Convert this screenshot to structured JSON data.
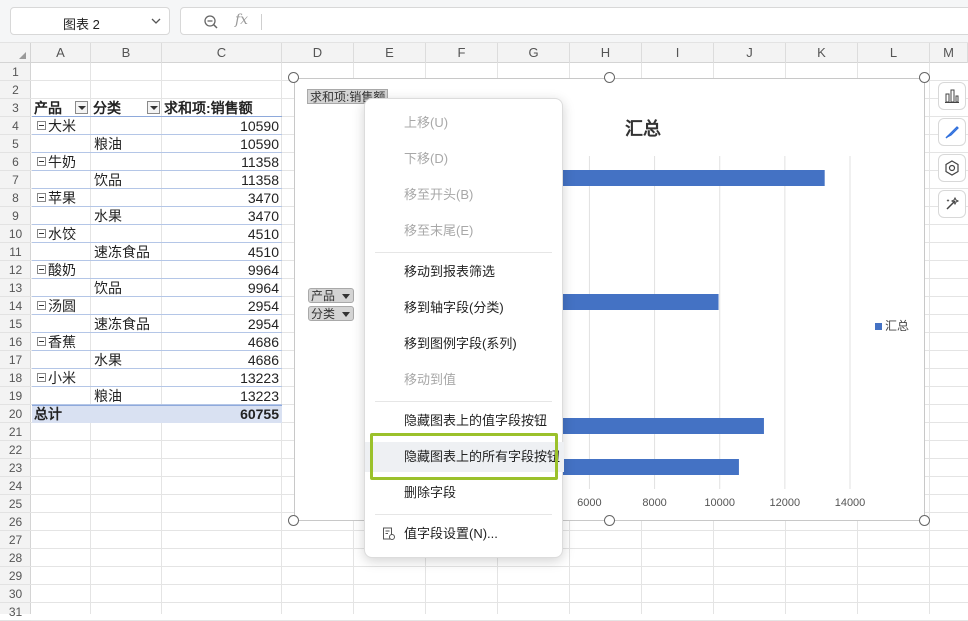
{
  "toolbar": {
    "name_box": "图表 2",
    "fx_label": "fx",
    "formula": ""
  },
  "columns": [
    "A",
    "B",
    "C",
    "D",
    "E",
    "F",
    "G",
    "H",
    "I",
    "J",
    "K",
    "L",
    "M"
  ],
  "rows": [
    "1",
    "2",
    "3",
    "4",
    "5",
    "6",
    "7",
    "8",
    "9",
    "10",
    "11",
    "12",
    "13",
    "14",
    "15",
    "16",
    "17",
    "18",
    "19",
    "20",
    "21",
    "22",
    "23",
    "24",
    "25",
    "26",
    "27",
    "28",
    "29",
    "30",
    "31"
  ],
  "pivot": {
    "headers": {
      "product": "产品",
      "category": "分类",
      "value": "求和项:销售额"
    },
    "groups": [
      {
        "product": "大米",
        "product_total": "10590",
        "category": "粮油",
        "category_total": "10590"
      },
      {
        "product": "牛奶",
        "product_total": "11358",
        "category": "饮品",
        "category_total": "11358"
      },
      {
        "product": "苹果",
        "product_total": "3470",
        "category": "水果",
        "category_total": "3470"
      },
      {
        "product": "水饺",
        "product_total": "4510",
        "category": "速冻食品",
        "category_total": "4510"
      },
      {
        "product": "酸奶",
        "product_total": "9964",
        "category": "饮品",
        "category_total": "9964"
      },
      {
        "product": "汤圆",
        "product_total": "2954",
        "category": "速冻食品",
        "category_total": "2954"
      },
      {
        "product": "香蕉",
        "product_total": "4686",
        "category": "水果",
        "category_total": "4686"
      },
      {
        "product": "小米",
        "product_total": "13223",
        "category": "粮油",
        "category_total": "13223"
      }
    ],
    "total_label": "总计",
    "total_value": "60755"
  },
  "chart_data": {
    "type": "bar",
    "title": "汇总",
    "value_field_button": "求和项:销售额",
    "axis_field_buttons": [
      "产品",
      "分类"
    ],
    "legend": [
      "汇总"
    ],
    "legend_position": "right",
    "orientation": "horizontal",
    "x_ticks": [
      "000",
      "6000",
      "8000",
      "10000",
      "12000",
      "14000"
    ],
    "xlim": [
      0,
      14000
    ],
    "grid": true,
    "visible_bars": [
      13223,
      4686,
      9964,
      4510,
      11358,
      10590
    ],
    "series_color": "#4472c4"
  },
  "context_menu": {
    "items": [
      {
        "label": "上移(U)",
        "enabled": false
      },
      {
        "label": "下移(D)",
        "enabled": false
      },
      {
        "label": "移至开头(B)",
        "enabled": false
      },
      {
        "label": "移至末尾(E)",
        "enabled": false
      },
      {
        "label": "移动到报表筛选",
        "enabled": true
      },
      {
        "label": "移到轴字段(分类)",
        "enabled": true
      },
      {
        "label": "移到图例字段(系列)",
        "enabled": true
      },
      {
        "label": "移动到值",
        "enabled": false
      },
      {
        "label": "隐藏图表上的值字段按钮",
        "enabled": true
      },
      {
        "label": "隐藏图表上的所有字段按钮",
        "enabled": true,
        "highlighted": true
      },
      {
        "label": "删除字段",
        "enabled": true
      },
      {
        "label": "值字段设置(N)...",
        "enabled": true,
        "icon": "field-settings-icon"
      }
    ]
  },
  "side_tools": [
    "chart-elements-icon",
    "chart-style-icon",
    "chart-filter-icon",
    "chart-wizard-icon"
  ],
  "colors": {
    "accent_highlight": "#9bc12b",
    "bar": "#4472c4",
    "pivot_band": "#d9e1f2"
  }
}
